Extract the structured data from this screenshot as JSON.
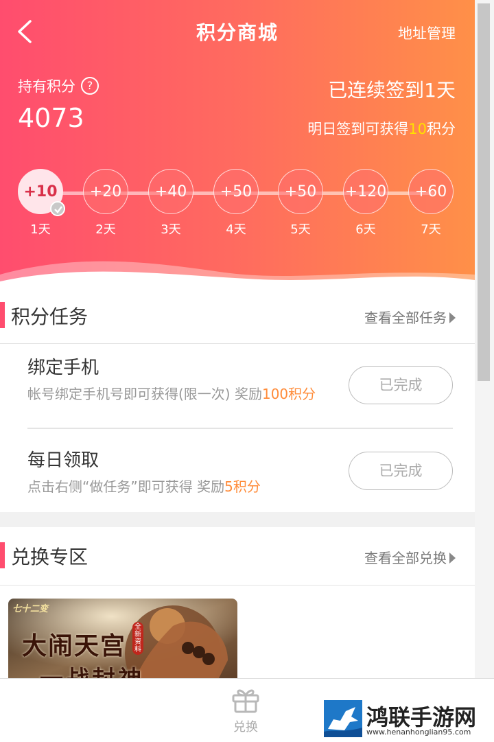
{
  "header": {
    "title": "积分商城",
    "address_link": "地址管理",
    "points_label": "持有积分",
    "points_value": "4073",
    "streak_text": "已连续签到1天",
    "tomorrow_prefix": "明日签到可获得",
    "tomorrow_points": "10",
    "tomorrow_suffix": "积分",
    "colors": {
      "gradient_start": "#ff4d6e",
      "gradient_end": "#ff9048",
      "highlight": "#ffe000"
    }
  },
  "checkin_days": [
    {
      "reward": "+10",
      "label": "1天",
      "checked": true
    },
    {
      "reward": "+20",
      "label": "2天",
      "checked": false
    },
    {
      "reward": "+40",
      "label": "3天",
      "checked": false
    },
    {
      "reward": "+50",
      "label": "4天",
      "checked": false
    },
    {
      "reward": "+50",
      "label": "5天",
      "checked": false
    },
    {
      "reward": "+120",
      "label": "6天",
      "checked": false
    },
    {
      "reward": "+60",
      "label": "7天",
      "checked": false
    }
  ],
  "tasks_section": {
    "title": "积分任务",
    "more": "查看全部任务",
    "tasks": [
      {
        "name": "绑定手机",
        "desc": "帐号绑定手机号即可获得(限一次) 奖励",
        "reward": "100积分",
        "button": "已完成"
      },
      {
        "name": "每日领取",
        "desc": "点击右侧“做任务”即可获得 奖励",
        "reward": "5积分",
        "button": "已完成"
      }
    ]
  },
  "exchange_section": {
    "title": "兑换专区",
    "more": "查看全部兑换",
    "product": {
      "badge": "七十二变",
      "line1": "大闹天宫",
      "line2": "一战封神",
      "tag": "全新资料"
    }
  },
  "bottom_nav": {
    "exchange_label": "兑换",
    "icon": "gift-icon"
  },
  "watermark": {
    "title": "鸿联手游网",
    "url": "www.henanhonglian95.com"
  }
}
